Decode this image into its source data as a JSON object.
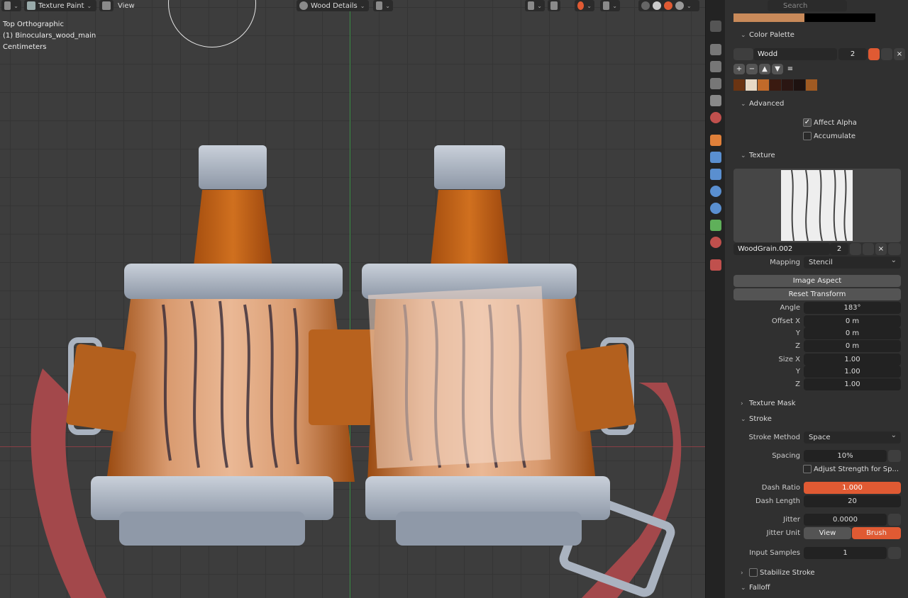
{
  "viewport": {
    "header": {
      "mode": "Texture Paint",
      "view_menu": "View",
      "material": "Wood Details"
    },
    "overlay": {
      "view_name": "Top Orthographic",
      "object_name": "(1) Binoculars_wood_main",
      "units": "Centimeters"
    }
  },
  "properties": {
    "search_placeholder": "Search",
    "color_palette": {
      "title": "Color Palette",
      "name": "Wodd",
      "users": "2",
      "swatches": [
        "#6b3412",
        "#e8d9c5",
        "#c06a2a",
        "#3a1a10",
        "#2a1612",
        "#1e1210",
        "#a05a22"
      ]
    },
    "advanced": {
      "title": "Advanced",
      "affect_alpha": "Affect Alpha",
      "accumulate": "Accumulate"
    },
    "texture": {
      "title": "Texture",
      "name": "WoodGrain.002",
      "users": "2",
      "mapping_label": "Mapping",
      "mapping": "Stencil",
      "image_aspect": "Image Aspect",
      "reset_transform": "Reset Transform",
      "angle_label": "Angle",
      "angle": "183°",
      "offset_x_label": "Offset X",
      "offset_x": "0 m",
      "offset_y_label": "Y",
      "offset_y": "0 m",
      "offset_z_label": "Z",
      "offset_z": "0 m",
      "size_x_label": "Size X",
      "size_x": "1.00",
      "size_y_label": "Y",
      "size_y": "1.00",
      "size_z_label": "Z",
      "size_z": "1.00"
    },
    "texture_mask": {
      "title": "Texture Mask"
    },
    "stroke": {
      "title": "Stroke",
      "method_label": "Stroke Method",
      "method": "Space",
      "spacing_label": "Spacing",
      "spacing": "10%",
      "adjust_strength": "Adjust Strength for Sp...",
      "dash_ratio_label": "Dash Ratio",
      "dash_ratio": "1.000",
      "dash_length_label": "Dash Length",
      "dash_length": "20",
      "jitter_label": "Jitter",
      "jitter": "0.0000",
      "jitter_unit_label": "Jitter Unit",
      "jitter_unit_view": "View",
      "jitter_unit_brush": "Brush",
      "input_samples_label": "Input Samples",
      "input_samples": "1",
      "stabilize_stroke": "Stabilize Stroke"
    },
    "falloff": {
      "title": "Falloff"
    }
  },
  "colors": {
    "accent": "#e05a33",
    "panel": "#303030",
    "field": "#222222",
    "button": "#545454"
  }
}
